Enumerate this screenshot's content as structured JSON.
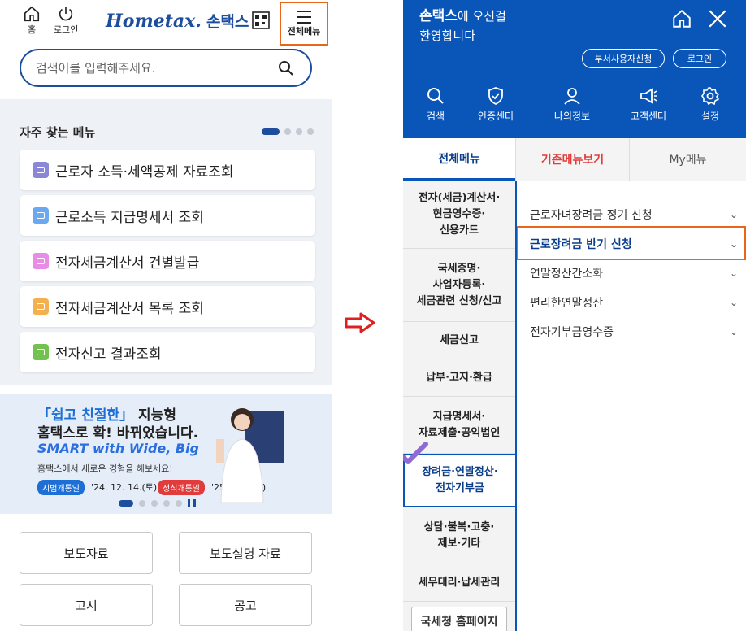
{
  "left": {
    "header": {
      "home_label": "홈",
      "login_label": "로그인",
      "logo_en": "Hometax.",
      "logo_ko": "손택스",
      "menu_label": "전체메뉴"
    },
    "search": {
      "placeholder": "검색어를 입력해주세요."
    },
    "favorites": {
      "title": "자주 찾는 메뉴",
      "items": [
        {
          "label": "근로자 소득·세액공제 자료조회",
          "color": "#8b86d8"
        },
        {
          "label": "근로소득 지급명세서 조회",
          "color": "#6aa9f0"
        },
        {
          "label": "전자세금계산서 건별발급",
          "color": "#e98ce5"
        },
        {
          "label": "전자세금계산서 목록 조회",
          "color": "#f3b04d"
        },
        {
          "label": "전자신고 결과조회",
          "color": "#71c24f"
        }
      ]
    },
    "banner": {
      "line1_highlight": "「쉽고 친절한」",
      "line1_rest": " 지능형",
      "line2": "홈택스로 확! 바뀌었습니다.",
      "line3": "SMART with Wide, Big",
      "line4": "홈택스에서 새로운 경험을 해보세요!",
      "badge1": "시범개통일",
      "date1": "'24. 12. 14.(토)",
      "badge2": "정식개통일",
      "date2": "'25. 1. 1.(수)"
    },
    "grid": [
      "보도자료",
      "보도설명 자료",
      "고시",
      "공고"
    ]
  },
  "right": {
    "welcome_brand": "손택스",
    "welcome_line1": "에 오신걸",
    "welcome_line2": "환영합니다",
    "pill1": "부서사용자신청",
    "pill2": "로그인",
    "nav": [
      "검색",
      "인증센터",
      "나의정보",
      "고객센터",
      "설정"
    ],
    "tabs": [
      "전체메뉴",
      "기존메뉴보기",
      "My메뉴"
    ],
    "categories": [
      "전자(세금)계산서·\n현금영수증·\n신용카드",
      "국세증명·\n사업자등록·\n세금관련 신청/신고",
      "세금신고",
      "납부·고지·환급",
      "지급명세서·\n자료제출·공익법인",
      "장려금·연말정산·\n전자기부금",
      "상담·불복·고충·\n제보·기타",
      "세무대리·납세관리"
    ],
    "selected_category": "장려금·연말정산·\n전자기부금",
    "subitems": [
      "근로자녀장려금 정기 신청",
      "근로장려금 반기 신청",
      "연말정산간소화",
      "편리한연말정산",
      "전자기부금영수증"
    ],
    "nts_button": "국세청 홈페이지"
  }
}
